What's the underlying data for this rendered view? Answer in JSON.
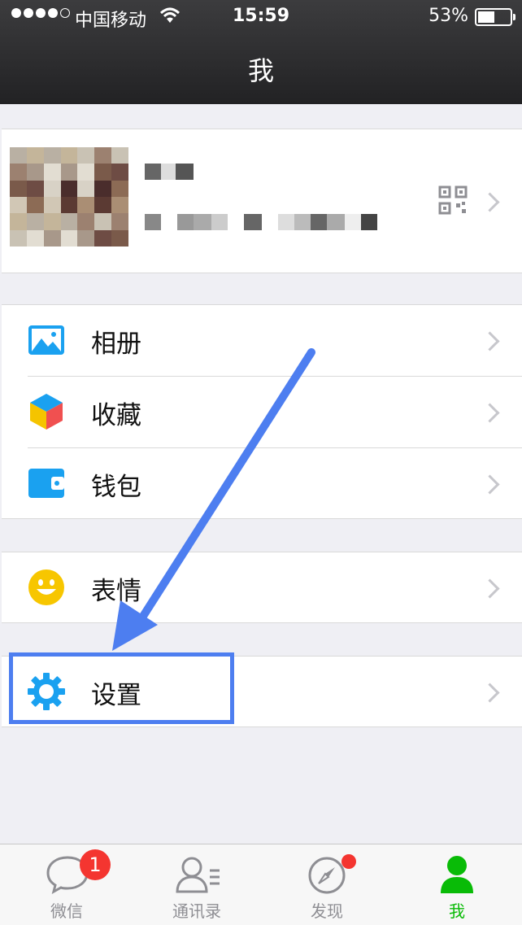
{
  "status": {
    "carrier": "中国移动",
    "time": "15:59",
    "battery_percent": "53%",
    "battery_level": 0.53
  },
  "header": {
    "title": "我"
  },
  "menu": {
    "album": "相册",
    "favorites": "收藏",
    "wallet": "钱包",
    "stickers": "表情",
    "settings": "设置"
  },
  "tabs": [
    {
      "label": "微信",
      "badge": "1"
    },
    {
      "label": "通讯录"
    },
    {
      "label": "发现"
    },
    {
      "label": "我"
    }
  ],
  "colors": {
    "accent": "#09bb07",
    "badge": "#f43530",
    "annotation": "#4d7ef0",
    "icon_blue": "#1aa1f0"
  }
}
